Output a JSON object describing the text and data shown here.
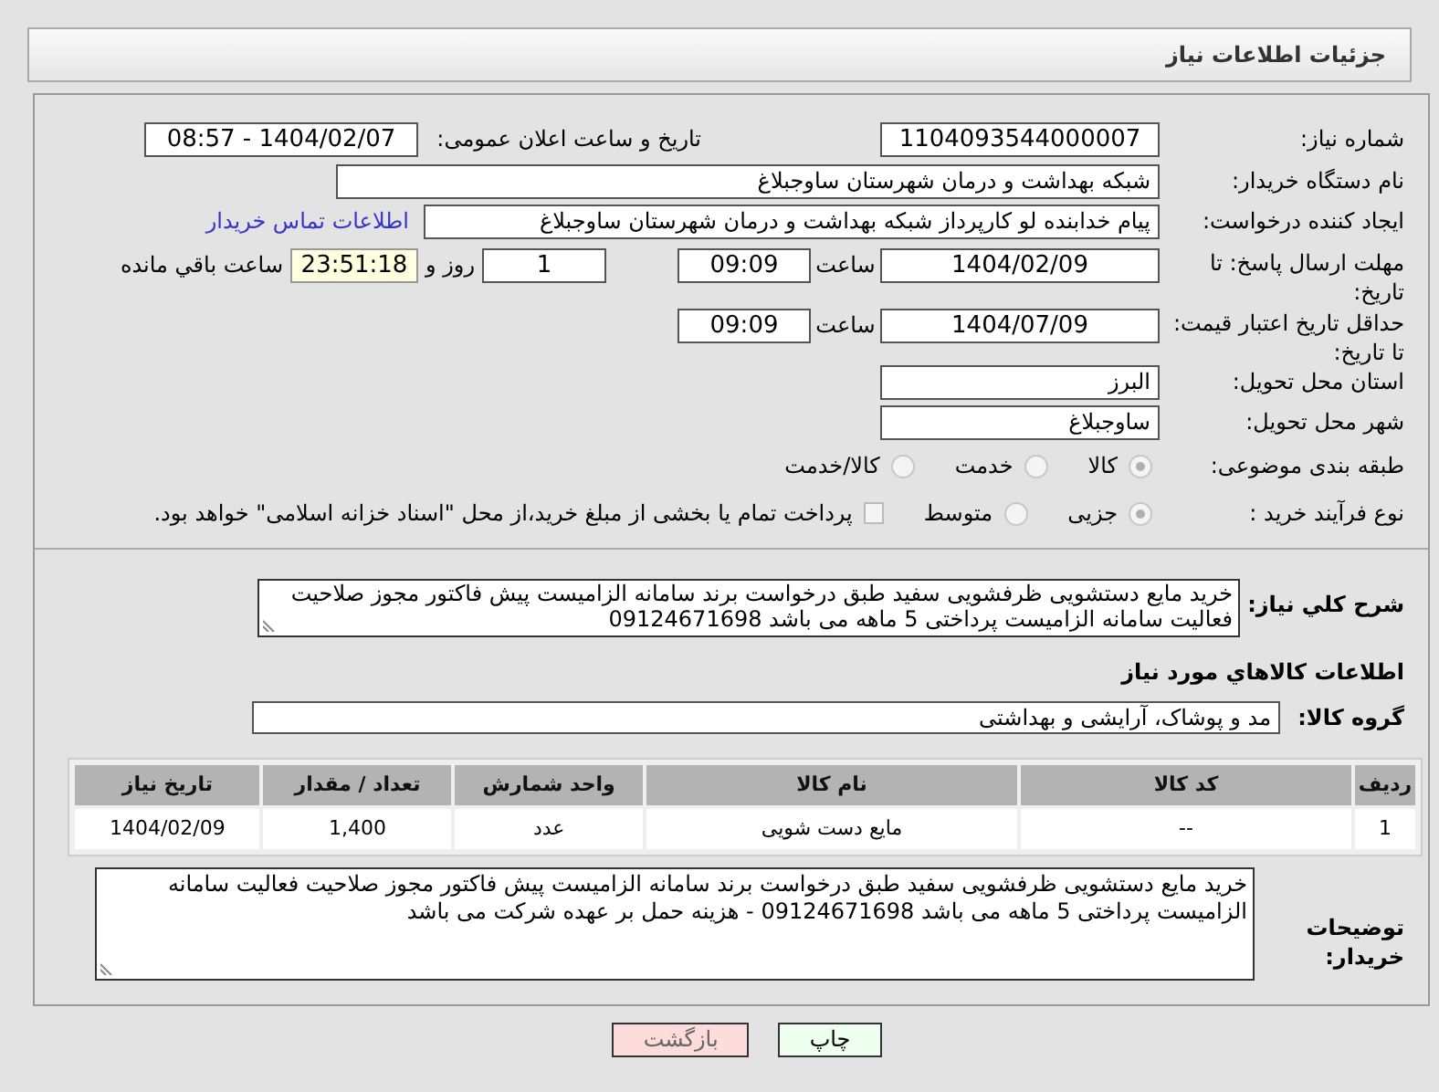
{
  "header": {
    "title": "جزئیات اطلاعات نیاز"
  },
  "need_number": {
    "label": "شماره نیاز:",
    "value": "1104093544000007"
  },
  "announce": {
    "label": "تاریخ و ساعت اعلان عمومی:",
    "value": "1404/02/07 - 08:57"
  },
  "buyer_org": {
    "label": "نام دستگاه خریدار:",
    "value": "شبکه بهداشت و درمان شهرستان ساوجبلاغ"
  },
  "requester": {
    "label": "ایجاد کننده درخواست:",
    "value": "پیام خدابنده لو کارپرداز شبکه بهداشت و درمان شهرستان ساوجبلاغ",
    "link": "اطلاعات تماس خریدار"
  },
  "reply_deadline": {
    "label": "مهلت ارسال پاسخ: تا تاریخ:",
    "date": "1404/02/09",
    "time_label": "ساعت",
    "time": "09:09",
    "days": "1",
    "days_label": "روز و",
    "remaining": "23:51:18",
    "remaining_label": "ساعت باقي مانده"
  },
  "price_validity": {
    "label": "حداقل تاریخ اعتبار قیمت: تا تاریخ:",
    "date": "1404/07/09",
    "time_label": "ساعت",
    "time": "09:09"
  },
  "province": {
    "label": "استان محل تحویل:",
    "value": "البرز"
  },
  "city": {
    "label": "شهر محل تحویل:",
    "value": "ساوجبلاغ"
  },
  "category": {
    "label": "طبقه بندی موضوعی:",
    "options": [
      {
        "label": "کالا",
        "selected": true
      },
      {
        "label": "خدمت",
        "selected": false
      },
      {
        "label": "کالا/خدمت",
        "selected": false
      }
    ]
  },
  "purchase_type": {
    "label": "نوع فرآیند خرید :",
    "options": [
      {
        "label": "جزیی",
        "selected": true
      },
      {
        "label": "متوسط",
        "selected": false
      }
    ],
    "payment_option": {
      "label": "پرداخت تمام یا بخشی از مبلغ خرید،از محل \"اسناد خزانه اسلامی\" خواهد بود.",
      "checked": false
    }
  },
  "description": {
    "label": "شرح کلي نياز:",
    "value": "خرید مایع دستشویی ظرفشویی سفید طبق درخواست برند سامانه الزامیست پیش فاکتور مجوز صلاحیت فعالیت سامانه الزامیست پرداختی 5 ماهه می باشد 09124671698"
  },
  "goods_heading": "اطلاعات کالاهاي مورد نياز",
  "goods_group": {
    "label": "گروه کالا:",
    "value": "مد و پوشاک، آرایشی و بهداشتی"
  },
  "table": {
    "columns": [
      "ردیف",
      "کد کالا",
      "نام کالا",
      "واحد شمارش",
      "تعداد / مقدار",
      "تاریخ نیاز"
    ],
    "rows": [
      [
        "1",
        "--",
        "مایع دست شویی",
        "عدد",
        "1,400",
        "1404/02/09"
      ]
    ]
  },
  "buyer_notes": {
    "label": "توضیحات خریدار:",
    "value": "خرید مایع دستشویی ظرفشویی سفید طبق درخواست برند سامانه الزامیست پیش فاکتور مجوز صلاحیت فعالیت سامانه الزامیست پرداختی 5 ماهه می باشد 09124671698 - هزینه حمل بر عهده شرکت می باشد"
  },
  "buttons": [
    {
      "label": "چاپ",
      "kind": "print"
    },
    {
      "label": "بازگشت",
      "kind": "back"
    }
  ]
}
